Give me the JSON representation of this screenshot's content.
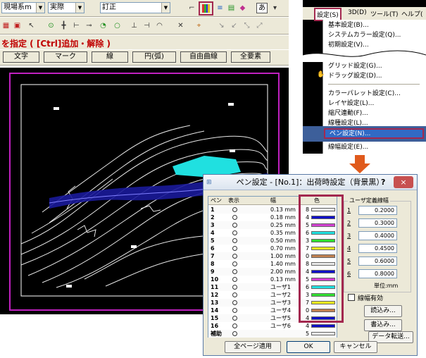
{
  "toolbar": {
    "combo1": "現場系m",
    "combo2": "実際",
    "combo3": "訂正",
    "text_mode": "あ"
  },
  "status": {
    "prompt": "を指定 ( [Ctrl]追加・解除 )"
  },
  "select_buttons": [
    "文字",
    "マーク",
    "線",
    "円(弧)",
    "自由曲線",
    "全要素"
  ],
  "menu": {
    "bar": [
      "設定(S)",
      "3D(D)",
      "ツール(T)",
      "ヘルプ("
    ],
    "items": [
      "基本設定(B)...",
      "システムカラー設定(Q)...",
      "初期設定(V)...",
      "グリッド設定(G)...",
      "ドラッグ設定(D)...",
      "カラーパレット設定(C)...",
      "レイヤ設定(L)...",
      "縮尺連動(F)...",
      "線種設定(L)...",
      "ペン設定(N)...",
      "線幅設定(E)..."
    ]
  },
  "dialog": {
    "title": "ペン設定 - [No.1]：出荷時設定（背景黒）",
    "help_btn": "?",
    "close_btn": "×",
    "headers": [
      "ペン",
      "表示",
      "幅",
      "色"
    ],
    "rows": [
      {
        "pen": "1",
        "width": "0.13 mm",
        "color_no": "8",
        "color": "#e8e8e8"
      },
      {
        "pen": "2",
        "width": "0.18 mm",
        "color_no": "4",
        "color": "#1010c8"
      },
      {
        "pen": "3",
        "width": "0.25 mm",
        "color_no": "5",
        "color": "#d040d0"
      },
      {
        "pen": "4",
        "width": "0.35 mm",
        "color_no": "6",
        "color": "#20e0e0"
      },
      {
        "pen": "5",
        "width": "0.50 mm",
        "color_no": "3",
        "color": "#30e030"
      },
      {
        "pen": "6",
        "width": "0.70 mm",
        "color_no": "7",
        "color": "#f0f020"
      },
      {
        "pen": "7",
        "width": "1.00 mm",
        "color_no": "0",
        "color": "#c08050"
      },
      {
        "pen": "8",
        "width": "1.40 mm",
        "color_no": "8",
        "color": "#e8e8e8"
      },
      {
        "pen": "9",
        "width": "2.00 mm",
        "color_no": "4",
        "color": "#1010c8"
      },
      {
        "pen": "10",
        "width": "0.13 mm",
        "color_no": "5",
        "color": "#d040d0"
      },
      {
        "pen": "11",
        "width": "ユーザ1",
        "color_no": "6",
        "color": "#20e0e0"
      },
      {
        "pen": "12",
        "width": "ユーザ2",
        "color_no": "3",
        "color": "#30e030"
      },
      {
        "pen": "13",
        "width": "ユーザ3",
        "color_no": "7",
        "color": "#f0f020"
      },
      {
        "pen": "14",
        "width": "ユーザ4",
        "color_no": "0",
        "color": "#c08050"
      },
      {
        "pen": "15",
        "width": "ユーザ5",
        "color_no": "4",
        "color": "#1010c8"
      },
      {
        "pen": "16",
        "width": "ユーザ6",
        "color_no": "4",
        "color": "#1010c8"
      },
      {
        "pen": "補助",
        "width": "",
        "color_no": "5",
        "color": "#e8e8e8"
      }
    ],
    "user_group_label": "ユーザ定義線幅",
    "user_widths": [
      {
        "label": "1",
        "value": "0.2000"
      },
      {
        "label": "2",
        "value": "0.3000"
      },
      {
        "label": "3",
        "value": "0.4000"
      },
      {
        "label": "4",
        "value": "0.4500"
      },
      {
        "label": "5",
        "value": "0.6000"
      },
      {
        "label": "6",
        "value": "0.8000"
      }
    ],
    "unit_label": "単位:mm",
    "linewidth_check": "線幅有効",
    "load_btn": "読込み...",
    "save_btn": "書込み...",
    "transfer_btn": "データ転送...",
    "apply_all_btn": "全ページ適用",
    "ok_btn": "OK",
    "cancel_btn": "キャンセル"
  },
  "colors": {
    "highlight": "#a3284f",
    "arrow": "#e05a1c",
    "selected_menu": "#316ac5"
  }
}
